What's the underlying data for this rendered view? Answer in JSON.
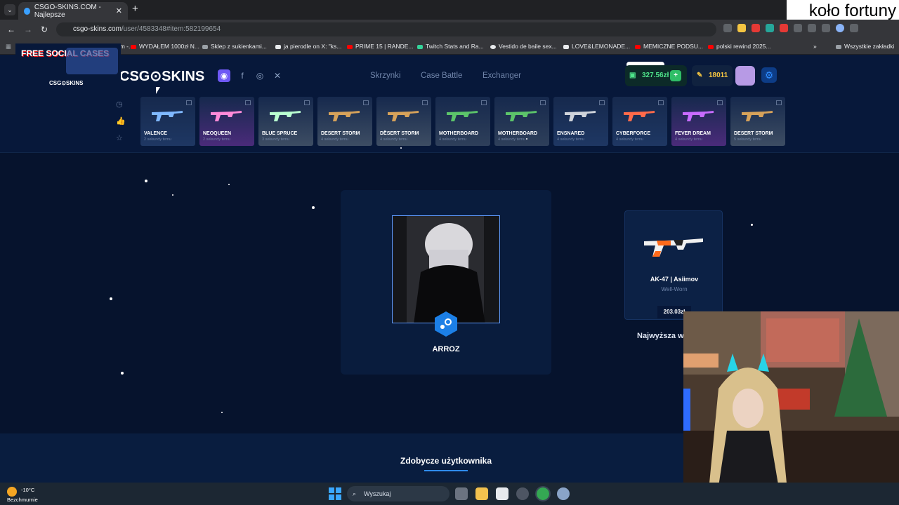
{
  "browser": {
    "tab_title": "CSGO-SKINS.COM - Najlepsze",
    "tab_close": "✕",
    "new_tab": "+",
    "url_host": "csgo-skins.com",
    "url_path": "/user/4583348#item:582199654",
    "bookmarks": [
      {
        "label": "YouTube Premium -..."
      },
      {
        "label": "WYDAŁEM 1000zł N..."
      },
      {
        "label": "Sklep z sukienkami..."
      },
      {
        "label": "ja pierodle on X: \"ks..."
      },
      {
        "label": "PRIME 15 | RANDE..."
      },
      {
        "label": "Twitch Stats and Ra..."
      },
      {
        "label": "Vestido de baile sex..."
      },
      {
        "label": "LOVE&LEMONADE..."
      },
      {
        "label": "MEMICZNE PODSU..."
      },
      {
        "label": "polski rewind 2025..."
      },
      {
        "label": "Wszystkie zakładki"
      }
    ]
  },
  "overlay": {
    "stream_title": "koło fortuny",
    "free_cases": "FREE SOCIAL CASES",
    "free_cases_logo": "CSG⊙SKINS"
  },
  "site": {
    "logo": "CSG⊙SKINS",
    "nav": [
      "Skrzynki",
      "Case Battle",
      "Exchanger"
    ],
    "balance": "327.56zł",
    "coins": "18011",
    "settings_icon": "⚙",
    "plus": "+",
    "recent_drops": [
      {
        "name": "VALENCE",
        "time": "2 sekundy temu",
        "color": "#1e3763"
      },
      {
        "name": "NEOQUEEN",
        "time": "2 sekundy temu",
        "color": "#4a2b7a"
      },
      {
        "name": "BLUE SPRUCE",
        "time": "3 sekundy temu",
        "color": "#3d4d63"
      },
      {
        "name": "DESERT STORM",
        "time": "4 sekundy temu",
        "color": "#3d4d63"
      },
      {
        "name": "DESERT STORM",
        "time": "4 sekundy temu",
        "color": "#3d4d63"
      },
      {
        "name": "MOTHERBOARD",
        "time": "4 sekundy temu",
        "color": "#2e3f5a"
      },
      {
        "name": "MOTHERBOARD",
        "time": "4 sekundy temu",
        "color": "#2e3f5a"
      },
      {
        "name": "ENSNARED",
        "time": "4 sekundy temu",
        "color": "#1e3763"
      },
      {
        "name": "CYBERFORCE",
        "time": "4 sekundy temu",
        "color": "#1e3763"
      },
      {
        "name": "FEVER DREAM",
        "time": "4 sekundy temu",
        "color": "#4a2b7a"
      },
      {
        "name": "DESERT STORM",
        "time": "5 sekundy temu",
        "color": "#3d4d63"
      }
    ],
    "profile": {
      "username": "ARROZ"
    },
    "best_drop": {
      "weapon": "AK-47 | Asiimov",
      "wear": "Well-Worn",
      "price": "203.03zł",
      "label": "Najwyższa w"
    },
    "section_title": "Zdobycze użytkownika"
  },
  "taskbar": {
    "temp": "-10°C",
    "weather": "Bezchmurnie",
    "search_placeholder": "Wyszukaj"
  }
}
